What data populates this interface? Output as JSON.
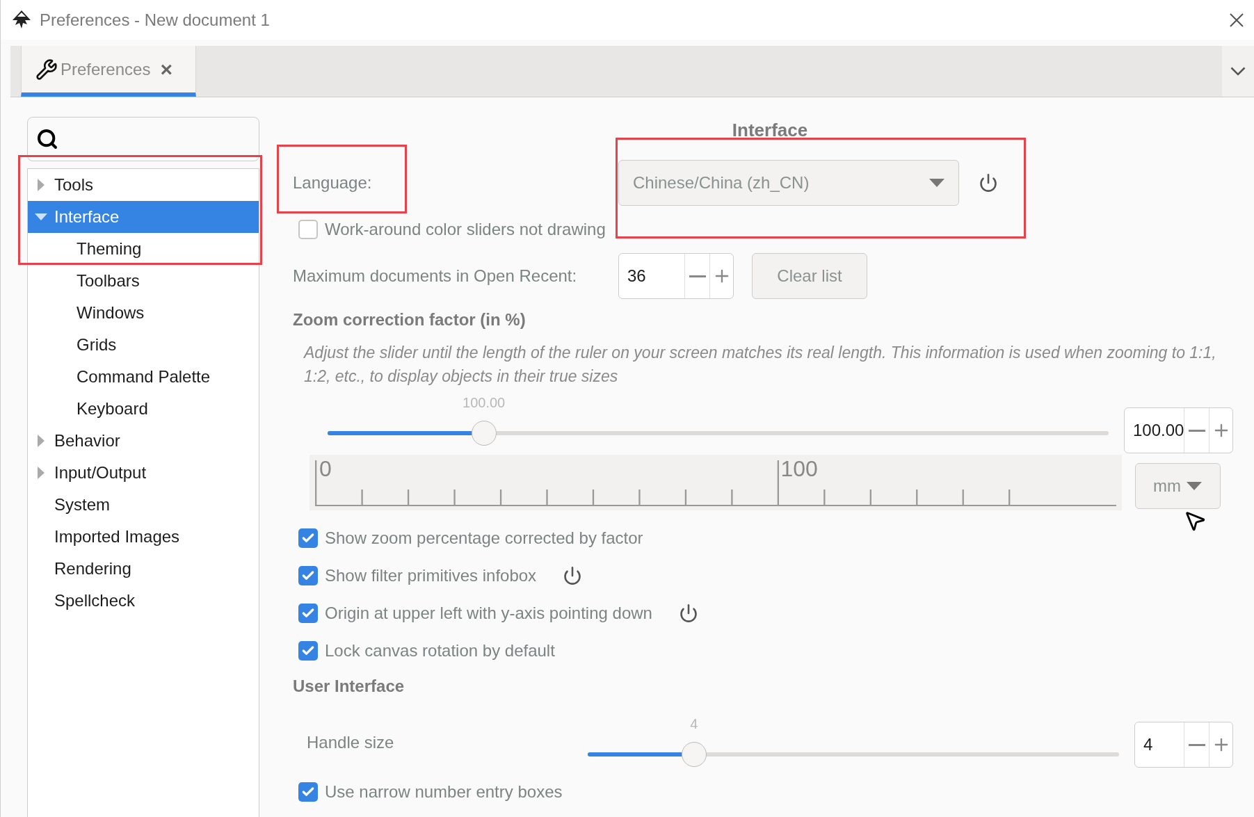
{
  "window": {
    "title": "Preferences - New document 1"
  },
  "tabs": [
    {
      "label": "Preferences",
      "selected": true,
      "close": "×"
    }
  ],
  "tree": [
    {
      "label": "Tools",
      "expanded": false,
      "selected": false
    },
    {
      "label": "Interface",
      "expanded": true,
      "selected": true,
      "children": [
        {
          "label": "Theming",
          "selected": false
        },
        {
          "label": "Toolbars",
          "selected": false
        },
        {
          "label": "Windows",
          "selected": false
        },
        {
          "label": "Grids",
          "selected": false
        },
        {
          "label": "Command Palette",
          "selected": false
        },
        {
          "label": "Keyboard",
          "selected": false
        }
      ]
    },
    {
      "label": "Behavior",
      "expanded": false,
      "selected": false
    },
    {
      "label": "Input/Output",
      "expanded": false,
      "selected": false
    },
    {
      "label": "System",
      "selected": false
    },
    {
      "label": "Imported Images",
      "selected": false
    },
    {
      "label": "Rendering",
      "selected": false
    },
    {
      "label": "Spellcheck",
      "selected": false
    }
  ],
  "page": {
    "title": "Interface",
    "language": {
      "label": "Language:",
      "value": "Chinese/China (zh_CN)",
      "restart": true
    },
    "workaround": {
      "label": "Work-around color sliders not drawing",
      "checked": false
    },
    "max_recent": {
      "label": "Maximum documents in Open Recent:",
      "value": "36",
      "button": "Clear list"
    },
    "zoom": {
      "heading": "Zoom correction factor (in %)",
      "description": "Adjust the slider until the length of the ruler on your screen matches its real length. This information is used when zooming to 1:1, 1:2, etc., to display objects in their true sizes",
      "slider_label": "100.00",
      "level": 0.2,
      "value": "100.00",
      "ruler_labels": [
        "0",
        "100"
      ],
      "unit": "mm"
    },
    "options": [
      {
        "label": "Show zoom percentage corrected by factor",
        "checked": true,
        "restart": false
      },
      {
        "label": "Show filter primitives infobox",
        "checked": true,
        "restart": true
      },
      {
        "label": "Origin at upper left with y-axis pointing down",
        "checked": true,
        "restart": true
      },
      {
        "label": "Lock canvas rotation by default",
        "checked": true,
        "restart": false
      }
    ],
    "ui": {
      "heading": "User Interface",
      "handle": {
        "label": "Handle size",
        "slider_label": "4",
        "level": 0.2,
        "value": "4"
      },
      "narrow": {
        "label": "Use narrow number entry boxes",
        "checked": true
      }
    }
  }
}
